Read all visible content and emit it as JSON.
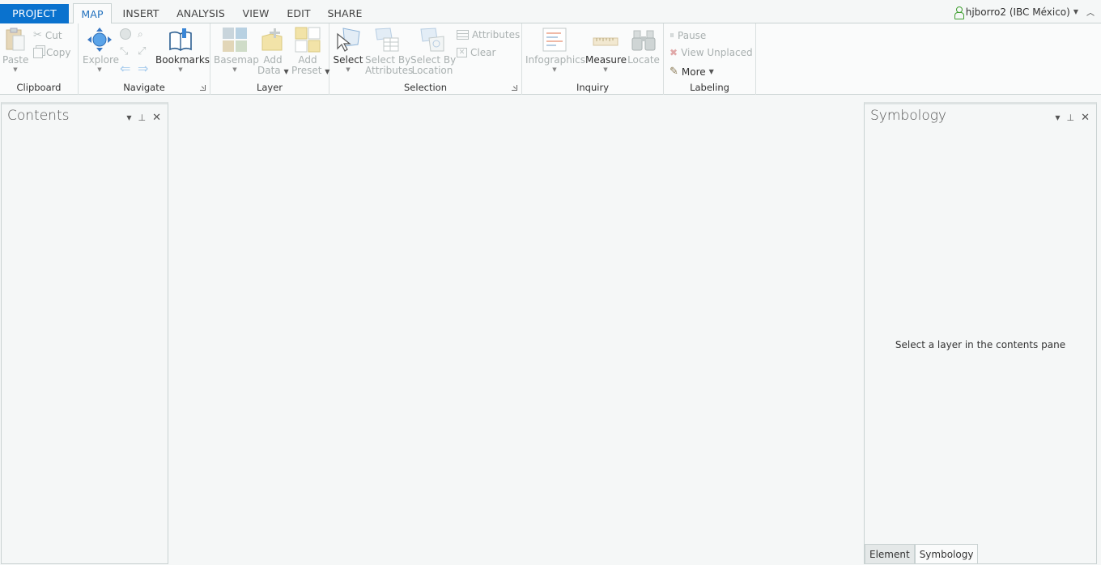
{
  "tabs": [
    {
      "label": "PROJECT"
    },
    {
      "label": "MAP"
    },
    {
      "label": "INSERT"
    },
    {
      "label": "ANALYSIS"
    },
    {
      "label": "VIEW"
    },
    {
      "label": "EDIT"
    },
    {
      "label": "SHARE"
    }
  ],
  "user": {
    "name": "hjborro2 (IBC México)"
  },
  "ribbon": {
    "clipboard": {
      "label": "Clipboard",
      "paste": "Paste",
      "cut": "Cut",
      "copy": "Copy"
    },
    "navigate": {
      "label": "Navigate",
      "explore": "Explore",
      "bookmarks": "Bookmarks"
    },
    "layer": {
      "label": "Layer",
      "basemap": "Basemap",
      "add_data_1": "Add",
      "add_data_2": "Data",
      "add_preset_1": "Add",
      "add_preset_2": "Preset"
    },
    "selection": {
      "label": "Selection",
      "select": "Select",
      "sba_1": "Select By",
      "sba_2": "Attributes",
      "sbl_1": "Select By",
      "sbl_2": "Location",
      "attributes": "Attributes",
      "clear": "Clear"
    },
    "inquiry": {
      "label": "Inquiry",
      "infographics": "Infographics",
      "measure": "Measure",
      "locate": "Locate"
    },
    "labeling": {
      "label": "Labeling",
      "pause": "Pause",
      "view_unplaced": "View Unplaced",
      "more": "More"
    }
  },
  "contents": {
    "title": "Contents"
  },
  "symbology": {
    "title": "Symbology",
    "message": "Select a layer in the contents pane"
  },
  "bottom_tabs": [
    {
      "label": "Element"
    },
    {
      "label": "Symbology"
    }
  ],
  "colors": {
    "accent": "#0a72ce",
    "active_tab_text": "#1f6fbd",
    "user_icon": "#3f9e2f"
  }
}
